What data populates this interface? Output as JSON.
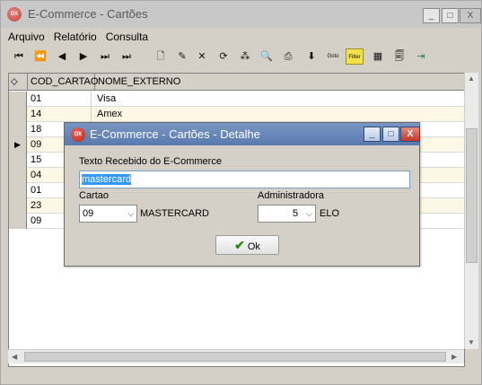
{
  "window": {
    "title": "E-Commerce - Cartões",
    "app_icon_text": "DX",
    "minimize": "_",
    "maximize": "□",
    "close": "X"
  },
  "menu": {
    "arquivo": "Arquivo",
    "relatorio": "Relatório",
    "consulta": "Consulta"
  },
  "toolbar": {
    "first": "⏮",
    "prev_page": "⏪",
    "prev": "◀",
    "next": "▶",
    "last": "⏭",
    "new": "🗋",
    "edit": "✎",
    "delete": "✕",
    "refresh": "⟳",
    "tools": "⁂",
    "preview": "🔍",
    "print": "⎙",
    "export": "⬇",
    "goto": "Goto",
    "filter": "Filter",
    "grid": "▦",
    "report": "🗐",
    "exit": "⇥"
  },
  "grid": {
    "columns": [
      "COD_CARTAO",
      "NOME_EXTERNO"
    ],
    "rows": [
      {
        "cod": "01",
        "nome": "Visa",
        "current": false
      },
      {
        "cod": "14",
        "nome": "Amex",
        "current": false
      },
      {
        "cod": "18",
        "nome": "",
        "current": false
      },
      {
        "cod": "09",
        "nome": "",
        "current": true
      },
      {
        "cod": "15",
        "nome": "",
        "current": false
      },
      {
        "cod": "04",
        "nome": "",
        "current": false
      },
      {
        "cod": "01",
        "nome": "",
        "current": false
      },
      {
        "cod": "23",
        "nome": "",
        "current": false
      },
      {
        "cod": "09",
        "nome": "",
        "current": false
      }
    ],
    "current_indicator": "▶"
  },
  "dialog": {
    "title": "E-Commerce - Cartões - Detalhe",
    "texto_label": "Texto Recebido do E-Commerce",
    "texto_value": "mastercard",
    "cartao_label": "Cartao",
    "cartao_value": "09",
    "cartao_name": "MASTERCARD",
    "adm_label": "Administradora",
    "adm_value": "5",
    "adm_name": "ELO",
    "ok_label": "Ok"
  },
  "colors": {
    "dialog_title_bg": "#6485b6",
    "row_alt": "#fdf7e6",
    "selection": "#3399ff",
    "close_red": "#c0392b"
  }
}
